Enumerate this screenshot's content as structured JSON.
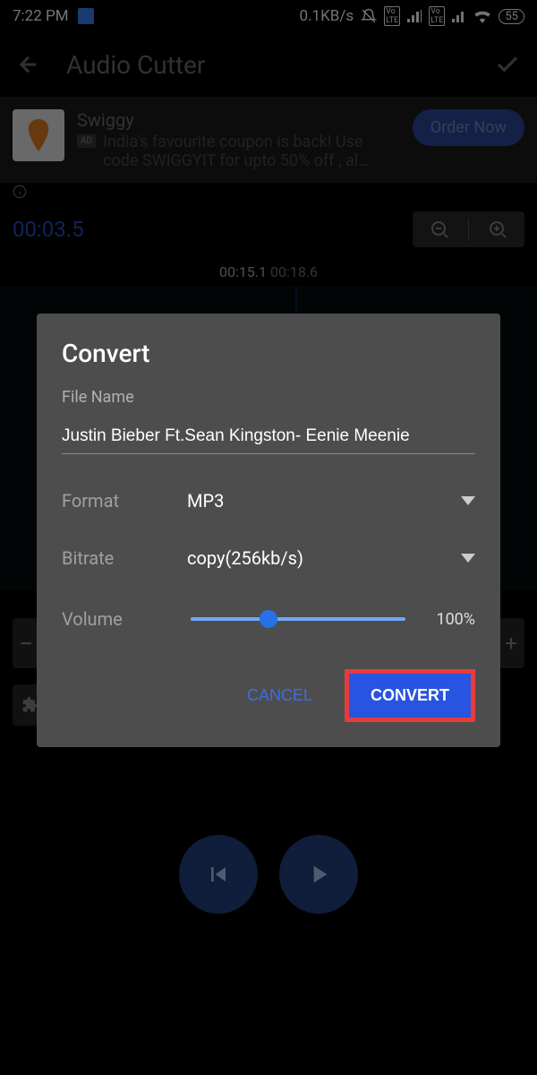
{
  "status": {
    "time": "7:22 PM",
    "net_speed": "0.1KB/s",
    "battery": "55"
  },
  "toolbar": {
    "title": "Audio Cutter"
  },
  "ad": {
    "title": "Swiggy",
    "description": "India's favourite coupon is back! Use code SWIGGYIT for upto 50% off , al…",
    "cta": "Order Now",
    "badge": "AD",
    "logo_text": "SWIGGY"
  },
  "timeline": {
    "current": "00:03.5",
    "marker_active": "00:15.1",
    "marker_next": "00:18.6"
  },
  "dialog": {
    "title": "Convert",
    "file_name_label": "File Name",
    "file_name": "Justin Bieber Ft.Sean Kingston- Eenie Meenie",
    "format_label": "Format",
    "format_value": "MP3",
    "bitrate_label": "Bitrate",
    "bitrate_value": "copy(256kb/s)",
    "volume_label": "Volume",
    "volume_value": "100%",
    "cancel": "CANCEL",
    "convert": "CONVERT"
  }
}
